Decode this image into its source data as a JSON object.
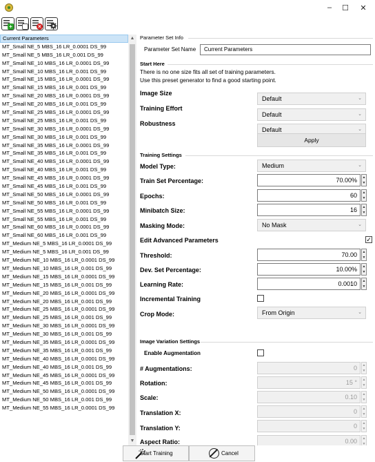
{
  "window": {
    "minimize_glyph": "–",
    "maximize_glyph": "☐",
    "close_glyph": "✕"
  },
  "toolbar": {
    "buttons": [
      {
        "icon": "add-preset-icon",
        "badge": "+",
        "color": "#2aa12a"
      },
      {
        "icon": "save-preset-icon",
        "badge": "",
        "color": "#555555"
      },
      {
        "icon": "delete-preset-icon",
        "badge": "×",
        "color": "#d22222"
      },
      {
        "icon": "settings-gear-icon",
        "badge": "",
        "color": "#333333"
      }
    ]
  },
  "presets": [
    "Current Parameters",
    "MT_Small NE_5 MBS_16 LR_0.0001 DS_99",
    "MT_Small NE_5 MBS_16 LR_0.001 DS_99",
    "MT_Small NE_10 MBS_16 LR_0.0001 DS_99",
    "MT_Small NE_10 MBS_16 LR_0.001 DS_99",
    "MT_Small NE_15 MBS_16 LR_0.0001 DS_99",
    "MT_Small NE_15 MBS_16 LR_0.001 DS_99",
    "MT_Small NE_20 MBS_16 LR_0.0001 DS_99",
    "MT_Small NE_20 MBS_16 LR_0.001 DS_99",
    "MT_Small NE_25 MBS_16 LR_0.0001 DS_99",
    "MT_Small NE_25 MBS_16 LR_0.001 DS_99",
    "MT_Small NE_30 MBS_16 LR_0.0001 DS_99",
    "MT_Small NE_30 MBS_16 LR_0.001 DS_99",
    "MT_Small NE_35 MBS_16 LR_0.0001 DS_99",
    "MT_Small NE_35 MBS_16 LR_0.001 DS_99",
    "MT_Small NE_40 MBS_16 LR_0.0001 DS_99",
    "MT_Small NE_40 MBS_16 LR_0.001 DS_99",
    "MT_Small NE_45 MBS_16 LR_0.0001 DS_99",
    "MT_Small NE_45 MBS_16 LR_0.001 DS_99",
    "MT_Small NE_50 MBS_16 LR_0.0001 DS_99",
    "MT_Small NE_50 MBS_16 LR_0.001 DS_99",
    "MT_Small NE_55 MBS_16 LR_0.0001 DS_99",
    "MT_Small NE_55 MBS_16 LR_0.001 DS_99",
    "MT_Small NE_60 MBS_16 LR_0.0001 DS_99",
    "MT_Small NE_60 MBS_16 LR_0.001 DS_99",
    "MT_Medium NE_5 MBS_16 LR_0.0001 DS_99",
    "MT_Medium NE_5 MBS_16 LR_0.001 DS_99",
    "MT_Medium NE_10 MBS_16 LR_0.0001 DS_99",
    "MT_Medium NE_10 MBS_16 LR_0.001 DS_99",
    "MT_Medium NE_15 MBS_16 LR_0.0001 DS_99",
    "MT_Medium NE_15 MBS_16 LR_0.001 DS_99",
    "MT_Medium NE_20 MBS_16 LR_0.0001 DS_99",
    "MT_Medium NE_20 MBS_16 LR_0.001 DS_99",
    "MT_Medium NE_25 MBS_16 LR_0.0001 DS_99",
    "MT_Medium NE_25 MBS_16 LR_0.001 DS_99",
    "MT_Medium NE_30 MBS_16 LR_0.0001 DS_99",
    "MT_Medium NE_30 MBS_16 LR_0.001 DS_99",
    "MT_Medium NE_35 MBS_16 LR_0.0001 DS_99",
    "MT_Medium NE_35 MBS_16 LR_0.001 DS_99",
    "MT_Medium NE_40 MBS_16 LR_0.0001 DS_99",
    "MT_Medium NE_40 MBS_16 LR_0.001 DS_99",
    "MT_Medium NE_45 MBS_16 LR_0.0001 DS_99",
    "MT_Medium NE_45 MBS_16 LR_0.001 DS_99",
    "MT_Medium NE_50 MBS_16 LR_0.0001 DS_99",
    "MT_Medium NE_50 MBS_16 LR_0.001 DS_99",
    "MT_Medium NE_55 MBS_16 LR_0.0001 DS_99"
  ],
  "selected_preset_index": 0,
  "parameter_set_info": {
    "title": "Parameter Set Info",
    "name_label": "Parameter Set Name",
    "name_value": "Current Parameters"
  },
  "start_here": {
    "title": "Start Here",
    "line1": "There is no one size fits all set of training parameters.",
    "line2": "Use this preset generator to find a good starting point.",
    "image_size_label": "Image Size",
    "image_size_value": "Default",
    "training_effort_label": "Training Effort",
    "training_effort_value": "Default",
    "robustness_label": "Robustness",
    "robustness_value": "Default",
    "apply_label": "Apply"
  },
  "training_settings": {
    "title": "Training Settings",
    "model_type_label": "Model Type:",
    "model_type_value": "Medium",
    "train_set_label": "Train Set Percentage:",
    "train_set_value": "70.00%",
    "epochs_label": "Epochs:",
    "epochs_value": "60",
    "minibatch_label": "Minibatch Size:",
    "minibatch_value": "16",
    "masking_label": "Masking Mode:",
    "masking_value": "No Mask",
    "edit_advanced_label": "Edit Advanced Parameters",
    "edit_advanced_checked": "✓",
    "threshold_label": "Threshold:",
    "threshold_value": "70.00",
    "dev_set_label": "Dev. Set Percentage:",
    "dev_set_value": "10.00%",
    "learning_rate_label": "Learning Rate:",
    "learning_rate_value": "0.0010",
    "incremental_label": "Incremental Training",
    "crop_mode_label": "Crop Mode:",
    "crop_mode_value": "From Origin"
  },
  "image_variation": {
    "title": "Image Variation Settings",
    "enable_label": "Enable Augmentation",
    "augmentations_label": "# Augmentations:",
    "augmentations_value": "0",
    "rotation_label": "Rotation:",
    "rotation_value": "15 °",
    "scale_label": "Scale:",
    "scale_value": "0.10",
    "translation_x_label": "Translation X:",
    "translation_x_value": "0",
    "translation_y_label": "Translation Y:",
    "translation_y_value": "0",
    "aspect_ratio_label": "Aspect Ratio:",
    "aspect_ratio_value": "0.00"
  },
  "bottom_bar": {
    "start_label": "Start Training",
    "cancel_label": "Cancel"
  }
}
